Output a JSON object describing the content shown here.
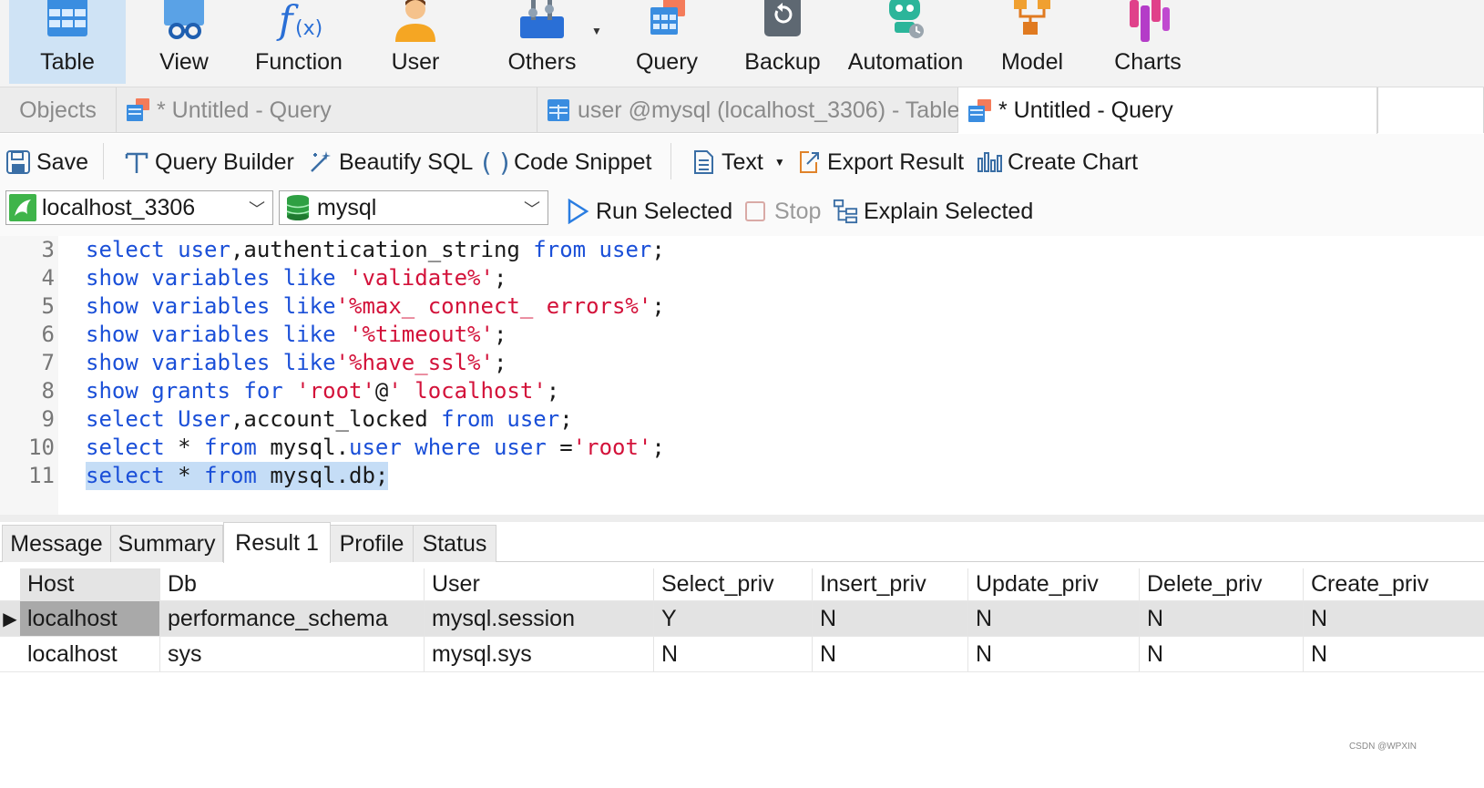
{
  "ribbon": {
    "items": [
      {
        "label": "Table",
        "icon": "table-icon",
        "active": true
      },
      {
        "label": "View",
        "icon": "view-icon"
      },
      {
        "label": "Function",
        "icon": "function-icon"
      },
      {
        "label": "User",
        "icon": "user-icon"
      },
      {
        "label": "Others",
        "icon": "others-icon"
      },
      {
        "label": "Query",
        "icon": "query-icon"
      },
      {
        "label": "Backup",
        "icon": "backup-icon"
      },
      {
        "label": "Automation",
        "icon": "automation-icon"
      },
      {
        "label": "Model",
        "icon": "model-icon"
      },
      {
        "label": "Charts",
        "icon": "charts-icon"
      }
    ]
  },
  "tabs": {
    "objects": "Objects",
    "tab1": "* Untitled - Query",
    "tab2": "user @mysql (localhost_3306) - Table",
    "tab3": "* Untitled - Query"
  },
  "toolbar": {
    "save": "Save",
    "query_builder": "Query Builder",
    "beautify": "Beautify SQL",
    "snippet": "Code Snippet",
    "text": "Text",
    "export": "Export Result",
    "create_chart": "Create Chart"
  },
  "connection": {
    "server": "localhost_3306",
    "database": "mysql",
    "run_selected": "Run Selected",
    "stop": "Stop",
    "explain": "Explain Selected"
  },
  "editor": {
    "lines": [
      {
        "num": "3",
        "text": "select user,authentication_string from user;"
      },
      {
        "num": "4",
        "text": "show variables like 'validate%';"
      },
      {
        "num": "5",
        "text": "show variables like'%max_ connect_ errors%';"
      },
      {
        "num": "6",
        "text": "show variables like '%timeout%';"
      },
      {
        "num": "7",
        "text": "show variables like'%have_ssl%';"
      },
      {
        "num": "8",
        "text": "show grants for 'root'@' localhost';"
      },
      {
        "num": "9",
        "text": "select User,account_locked from user;"
      },
      {
        "num": "10",
        "text": "select * from mysql.user where user ='root';"
      },
      {
        "num": "11",
        "text": "select * from mysql.db;",
        "selected": true
      }
    ]
  },
  "result_tabs": [
    "Message",
    "Summary",
    "Result 1",
    "Profile",
    "Status"
  ],
  "active_result_tab": "Result 1",
  "grid": {
    "columns": [
      "Host",
      "Db",
      "User",
      "Select_priv",
      "Insert_priv",
      "Update_priv",
      "Delete_priv",
      "Create_priv"
    ],
    "rows": [
      [
        "localhost",
        "performance_schema",
        "mysql.session",
        "Y",
        "N",
        "N",
        "N",
        "N"
      ],
      [
        "localhost",
        "sys",
        "mysql.sys",
        "N",
        "N",
        "N",
        "N",
        "N"
      ]
    ]
  },
  "watermark": "CSDN @WPXIN",
  "colors": {
    "keyword": "#1a4fd8",
    "string": "#d3123a",
    "selection": "#c5ddf6",
    "active_ribbon": "#cfe3f5"
  }
}
